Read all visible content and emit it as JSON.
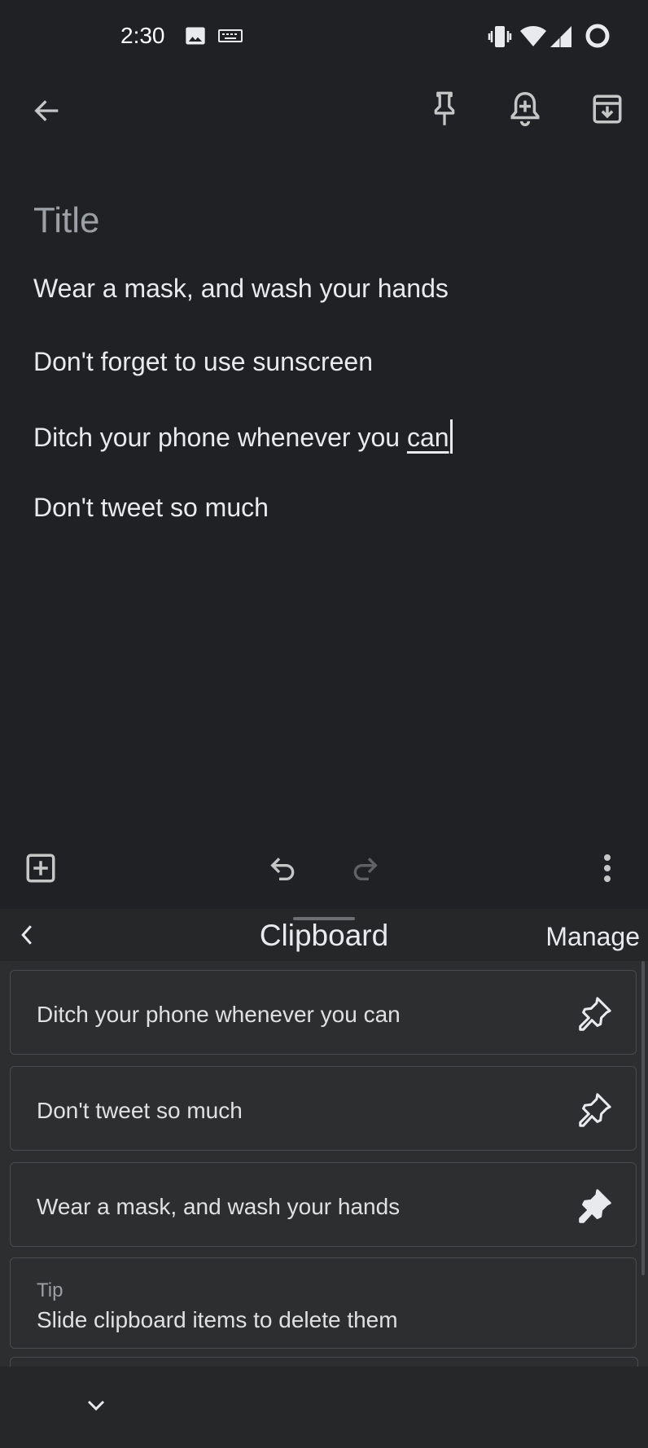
{
  "status_bar": {
    "time": "2:30",
    "icons": [
      "image-icon",
      "keyboard-icon",
      "vibrate-icon",
      "wifi-icon",
      "signal-icon",
      "battery-ring-icon"
    ]
  },
  "toolbar": {
    "icons": [
      "back-arrow-icon",
      "pin-icon",
      "reminder-bell-icon",
      "archive-icon"
    ]
  },
  "note": {
    "title_placeholder": "Title",
    "lines": [
      "Wear a mask, and wash your hands",
      "Don't forget to use sunscreen",
      "Ditch your phone whenever you ",
      "Don't tweet so much"
    ],
    "line3_underlined": "can"
  },
  "editor_bar": {
    "icons": [
      "add-box-icon",
      "undo-icon",
      "redo-icon",
      "more-vert-icon"
    ]
  },
  "clipboard": {
    "title": "Clipboard",
    "manage": "Manage",
    "items": [
      {
        "text": "Ditch your phone whenever you can",
        "pinned": false
      },
      {
        "text": "Don't tweet so much",
        "pinned": false
      },
      {
        "text": "Wear a mask, and wash your hands",
        "pinned": true
      }
    ],
    "tip_label": "Tip",
    "tip_text": "Slide clipboard items to delete them"
  },
  "colors": {
    "background": "#202124",
    "keyboard": "#2d2e30",
    "text": "#e8eaed",
    "muted": "#9aa0a6"
  }
}
